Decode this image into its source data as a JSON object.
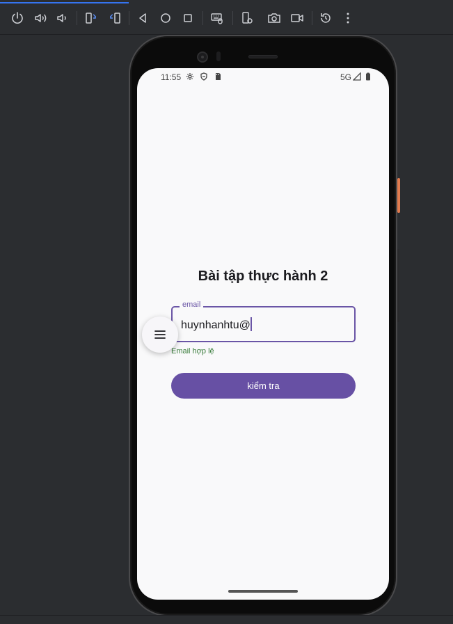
{
  "toolbar": {
    "buttons": [
      {
        "name": "power-icon"
      },
      {
        "name": "volume-up-icon"
      },
      {
        "name": "volume-down-icon"
      },
      {
        "name": "rotate-left-icon"
      },
      {
        "name": "rotate-right-icon"
      },
      {
        "name": "back-icon"
      },
      {
        "name": "home-icon"
      },
      {
        "name": "overview-icon"
      },
      {
        "name": "keyboard-mouse-icon"
      },
      {
        "name": "device-settings-icon"
      },
      {
        "name": "screenshot-icon"
      },
      {
        "name": "screen-record-icon"
      },
      {
        "name": "reset-icon"
      },
      {
        "name": "more-options-icon"
      }
    ]
  },
  "status_bar": {
    "time": "11:55",
    "network": "5G"
  },
  "app": {
    "title": "Bài tập thực hành 2",
    "email_label": "email",
    "email_value": "huynhanhtu@",
    "helper_text": "Email hợp lệ",
    "check_button_label": "kiểm tra",
    "helper_color": "#3a7d3c",
    "accent_color": "#6750a4"
  }
}
